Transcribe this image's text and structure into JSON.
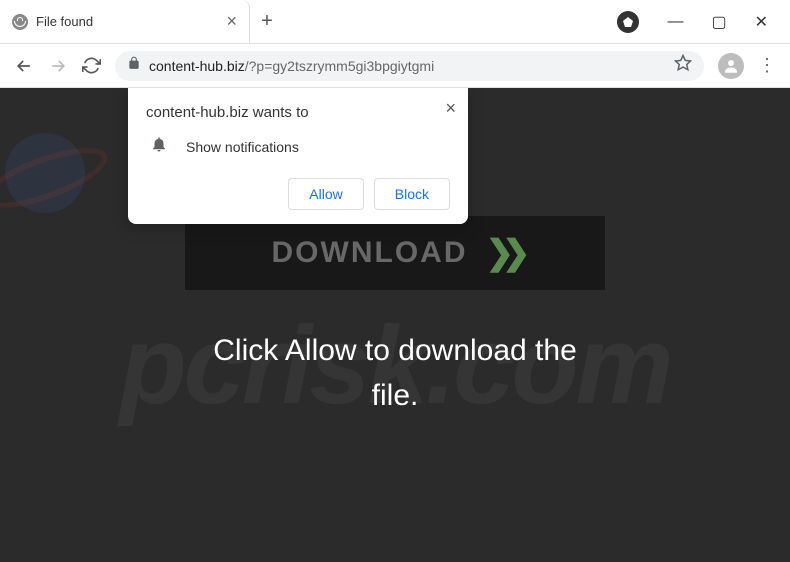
{
  "tab": {
    "title": "File found"
  },
  "url": {
    "domain": "content-hub.biz",
    "path": "/?p=gy2tszrymm5gi3bpgiytgmi"
  },
  "popup": {
    "title": "content-hub.biz wants to",
    "permission": "Show notifications",
    "allow": "Allow",
    "block": "Block"
  },
  "page": {
    "download_label": "DOWNLOAD",
    "message_line1": "Click Allow to download the",
    "message_line2": "file."
  },
  "watermark": "pcrisk.com"
}
